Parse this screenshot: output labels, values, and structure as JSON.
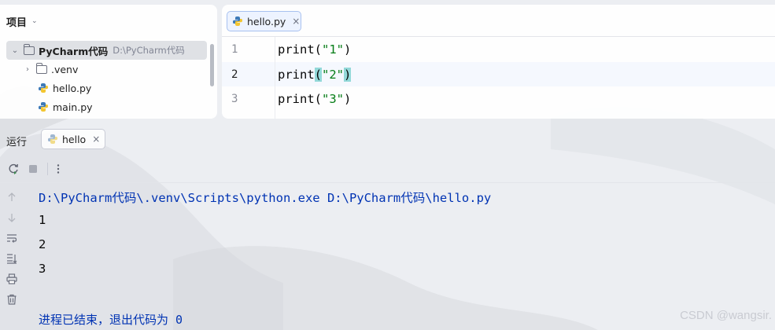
{
  "project_panel": {
    "title": "项目",
    "tree": [
      {
        "label": "PyCharm代码",
        "path": "D:\\PyCharm代码"
      },
      {
        "label": ".venv"
      },
      {
        "label": "hello.py"
      },
      {
        "label": "main.py"
      }
    ]
  },
  "editor": {
    "tab_label": "hello.py",
    "line_numbers": [
      "1",
      "2",
      "3"
    ],
    "code": [
      {
        "fn": "print(",
        "str": "\"1\"",
        "close": ")"
      },
      {
        "fn": "print",
        "open": "(",
        "str": "\"2\"",
        "close": ")"
      },
      {
        "fn": "print(",
        "str": "\"3\"",
        "close": ")"
      }
    ]
  },
  "run_panel": {
    "label": "运行",
    "tab_label": "hello",
    "console": {
      "command": "D:\\PyCharm代码\\.venv\\Scripts\\python.exe D:\\PyCharm代码\\hello.py",
      "outputs": [
        "1",
        "2",
        "3"
      ],
      "exit_message": "进程已结束，退出代码为 0"
    }
  },
  "watermark": "CSDN @wangsir.",
  "colors": {
    "string": "#067d17",
    "bracket_highlight": "#93d9d9",
    "console_system": "#0033b3",
    "selection": "#dfe1e5",
    "tab_active_border": "#a8c1f0"
  }
}
